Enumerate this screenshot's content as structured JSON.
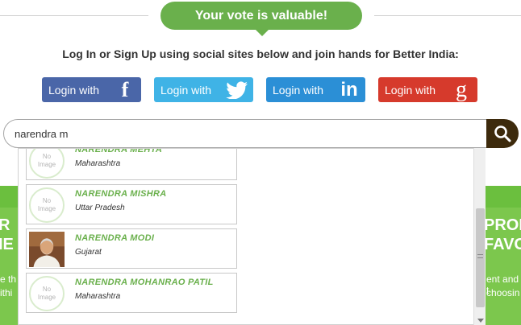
{
  "banner": {
    "title": "Your vote is valuable!"
  },
  "subtitle": "Log In or Sign Up using social sites below and join hands for Better India:",
  "social": {
    "facebook": {
      "label": "Login with",
      "glyph": "f"
    },
    "twitter": {
      "label": "Login with"
    },
    "linkedin": {
      "label": "Login with",
      "glyph": "in"
    },
    "google": {
      "label": "Login with",
      "glyph": "g"
    }
  },
  "search": {
    "value": "narendra m"
  },
  "no_image": {
    "line1": "No",
    "line2": "Image"
  },
  "results": [
    {
      "name": "NARENDRA MEHTA",
      "state": "Maharashtra"
    },
    {
      "name": "NARENDRA MISHRA",
      "state": "Uttar Pradesh"
    },
    {
      "name": "NARENDRA MODI",
      "state": "Gujarat"
    },
    {
      "name": "NARENDRA MOHANRAO PATIL",
      "state": "Maharashtra"
    }
  ],
  "background": {
    "left_big": [
      "R",
      "IE"
    ],
    "left_small": [
      "e th",
      "ithi"
    ],
    "right_big": [
      "PROM",
      "FAVO"
    ],
    "right_small": [
      "ent and t",
      "choosin"
    ]
  },
  "colors": {
    "brand_green": "#6ab04c",
    "search_button": "#3d2a0c",
    "facebook": "#4a66a8",
    "twitter": "#3fb3e6",
    "linkedin": "#2b8fd6",
    "google": "#d63a2c"
  }
}
